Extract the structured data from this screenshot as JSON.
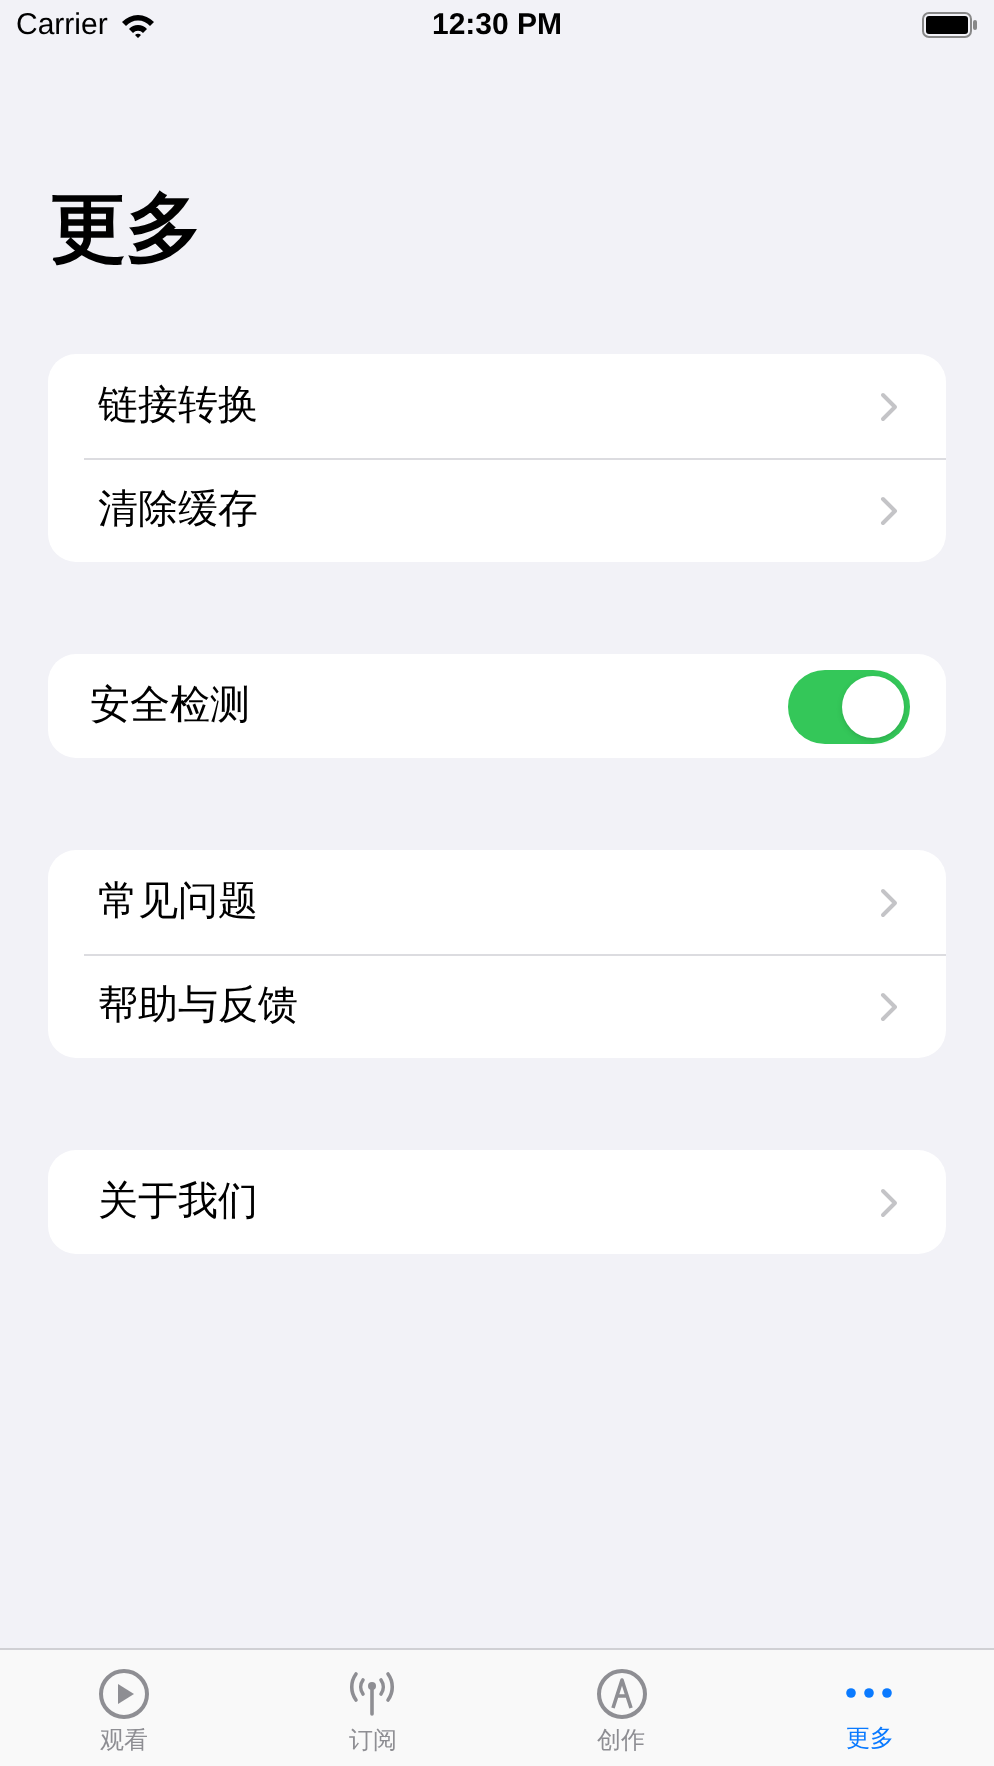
{
  "status_bar": {
    "carrier": "Carrier",
    "time": "12:30 PM"
  },
  "title": "更多",
  "sections": [
    {
      "rows": [
        {
          "kind": "link",
          "label": "链接转换"
        },
        {
          "kind": "link",
          "label": "清除缓存"
        }
      ]
    },
    {
      "rows": [
        {
          "kind": "toggle",
          "label": "安全检测",
          "on": true
        }
      ]
    },
    {
      "rows": [
        {
          "kind": "link",
          "label": "常见问题"
        },
        {
          "kind": "link",
          "label": "帮助与反馈"
        }
      ]
    },
    {
      "rows": [
        {
          "kind": "link",
          "label": "关于我们"
        }
      ]
    }
  ],
  "tab_bar": [
    {
      "kind": "play",
      "label": "观看",
      "selected": false
    },
    {
      "kind": "antenna",
      "label": "订阅",
      "selected": false
    },
    {
      "kind": "pen",
      "label": "创作",
      "selected": false
    },
    {
      "kind": "more",
      "label": "更多",
      "selected": true
    }
  ]
}
